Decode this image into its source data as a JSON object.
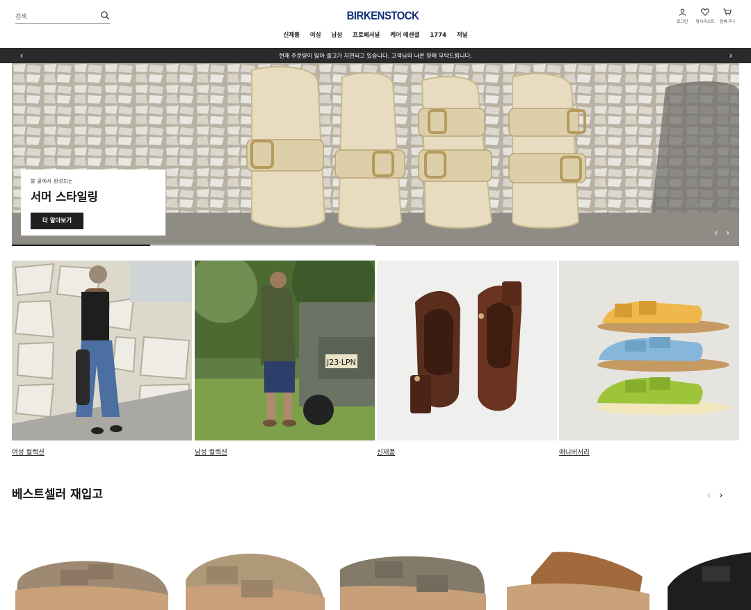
{
  "header": {
    "search_placeholder": "검색",
    "logo": "BIRKENSTOCK",
    "login_label": "로그인",
    "wishlist_label": "위시리스트",
    "cart_label": "장바구니"
  },
  "nav": {
    "items": [
      "신제품",
      "여성",
      "남성",
      "프로페셔널",
      "케어 에센셜",
      "1774",
      "저널"
    ]
  },
  "announcement": {
    "text": "현재 주문량이 많아 출고가 지연되고 있습니다. 고객님의 너른 양해 부탁드립니다.",
    "prev": "‹",
    "next": "›"
  },
  "hero": {
    "subtitle": "발 끝에서 완성되는",
    "title": "서머 스타일링",
    "cta": "더 알아보기",
    "prev": "‹",
    "next": "›",
    "progress": 0.38
  },
  "categories": [
    {
      "label": "여성 컬렉션"
    },
    {
      "label": "남성 컬렉션"
    },
    {
      "label": "신제품"
    },
    {
      "label": "애니버서리"
    }
  ],
  "bestsellers": {
    "title": "베스트셀러 재입고",
    "prev": "‹",
    "next": "›"
  },
  "colors": {
    "brand": "#12307a",
    "announce_bg": "#2a2a2a",
    "button_bg": "#1f1f1f"
  }
}
